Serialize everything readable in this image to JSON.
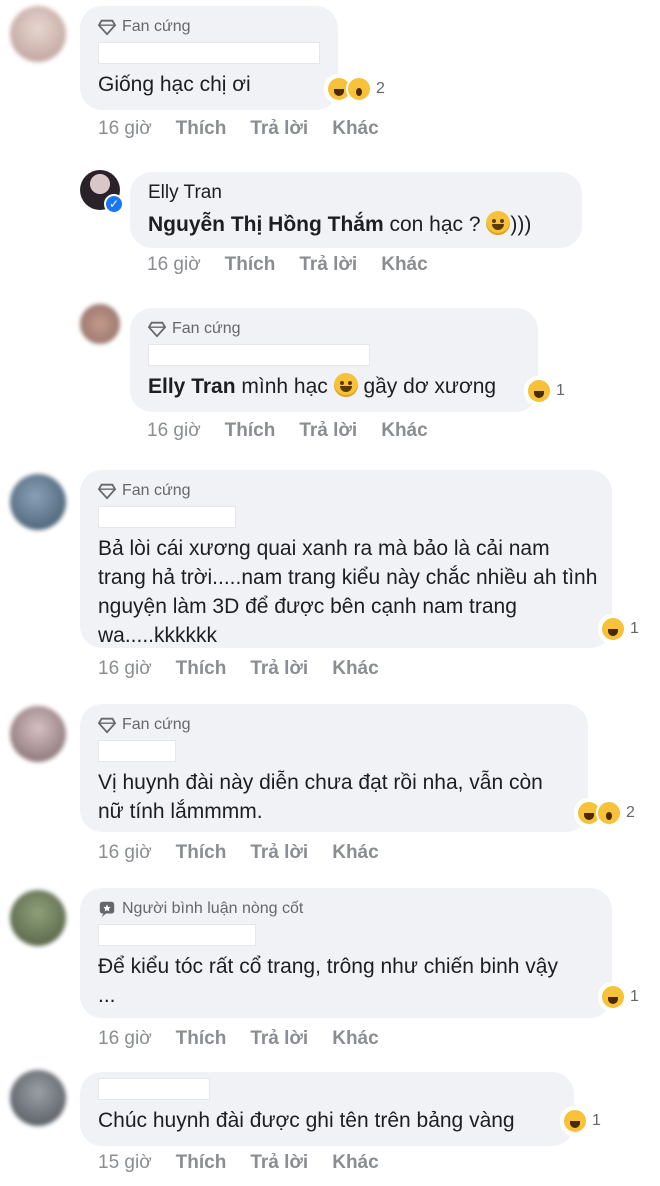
{
  "actions": {
    "like": "Thích",
    "reply": "Trả lời",
    "more": "Khác"
  },
  "comments": [
    {
      "badge": "Fan cứng",
      "text": "Giống hạc chị ơi",
      "reaction_count": "2",
      "time": "16 giờ"
    },
    {
      "author": "Elly Tran",
      "mention": "Nguyễn Thị Hồng Thắm",
      "text_after": " con hạc ? ",
      "suffix": ")))",
      "time": "16 giờ"
    },
    {
      "badge": "Fan cứng",
      "mention": "Elly Tran",
      "text_mid": " mình hạc ",
      "text_after": " gầy dơ xương",
      "reaction_count": "1",
      "time": "16 giờ"
    },
    {
      "badge": "Fan cứng",
      "text": "Bả lòi cái xương quai xanh ra mà bảo là cải nam trang hả trời.....nam trang kiểu này chắc nhiều ah tình nguyện làm 3D để được bên cạnh nam trang wa.....kkkkkk",
      "reaction_count": "1",
      "time": "16 giờ"
    },
    {
      "badge": "Fan cứng",
      "text": "Vị huynh đài này diễn chưa đạt rồi nha, vẫn còn nữ tính lắmmmm.",
      "reaction_count": "2",
      "time": "16 giờ"
    },
    {
      "badge": "Người bình luận nòng cốt",
      "text": "Để kiểu tóc rất cổ trang, trông như chiến binh vậy ...",
      "reaction_count": "1",
      "time": "16 giờ"
    },
    {
      "text": "Chúc huynh đài được ghi tên trên bảng vàng",
      "reaction_count": "1",
      "time": "15 giờ"
    }
  ]
}
